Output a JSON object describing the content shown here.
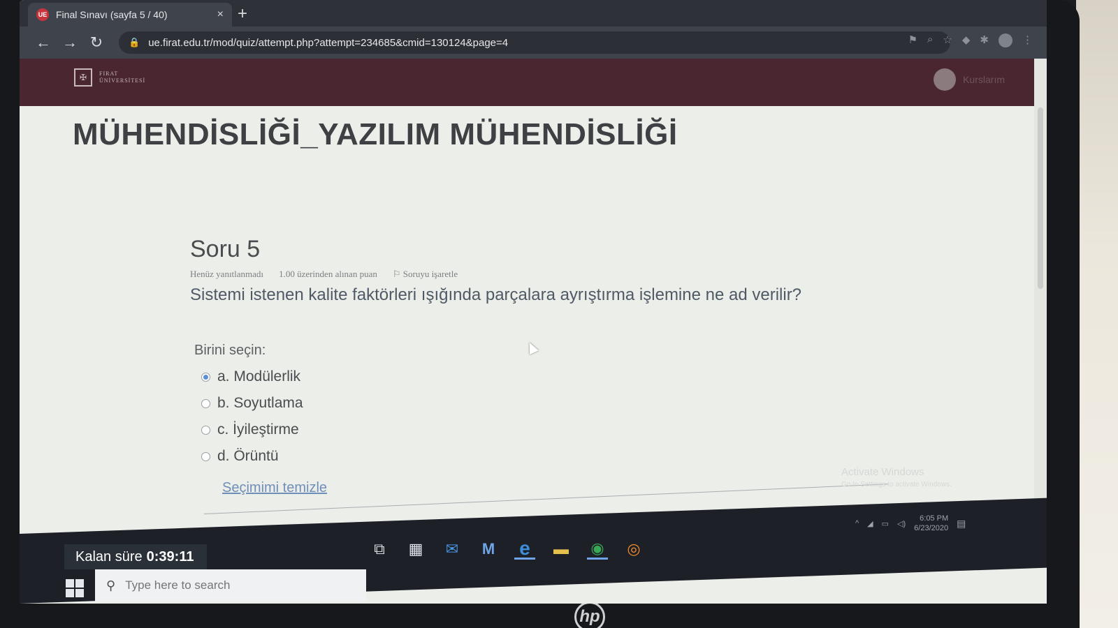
{
  "browser": {
    "tab_title": "Final Sınavı (sayfa 5 / 40)",
    "tab_close": "×",
    "new_tab": "+",
    "url": "ue.firat.edu.tr/mod/quiz/attempt.php?attempt=234685&cmid=130124&page=4"
  },
  "site": {
    "logo_line1": "FIRAT",
    "logo_line2": "ÜNİVERSİTESİ",
    "user_menu_label": "Kurslarım"
  },
  "course": {
    "title": "MÜHENDİSLİĞİ_YAZILIM MÜHENDİSLİĞİ"
  },
  "question": {
    "number_label": "Soru 5",
    "status": "Henüz yanıtlanmadı",
    "points": "1.00 üzerinden alınan puan",
    "flag_label": "Soruyu işaretle",
    "text": "Sistemi istenen kalite faktörleri ışığında parçalara ayrıştırma işlemine ne ad verilir?",
    "choose_label": "Birini seçin:",
    "options": [
      {
        "label": "a. Modülerlik",
        "selected": true
      },
      {
        "label": "b. Soyutlama",
        "selected": false
      },
      {
        "label": "c. İyileştirme",
        "selected": false
      },
      {
        "label": "d. Örüntü",
        "selected": false
      }
    ],
    "clear_label": "Seçimimi temizle"
  },
  "timer": {
    "label": "Kalan süre",
    "value": "0:39:11"
  },
  "watermark": {
    "title": "Activate Windows",
    "subtitle": "Go to Settings to activate Windows."
  },
  "taskbar": {
    "search_placeholder": "Type here to search",
    "clock_time": "6:05 PM",
    "clock_date": "6/23/2020"
  },
  "colors": {
    "site_nav": "#4a2630",
    "accent_link": "#6f8fb8",
    "timer_bg": "#2a3038"
  },
  "monitor_brand": "hp"
}
